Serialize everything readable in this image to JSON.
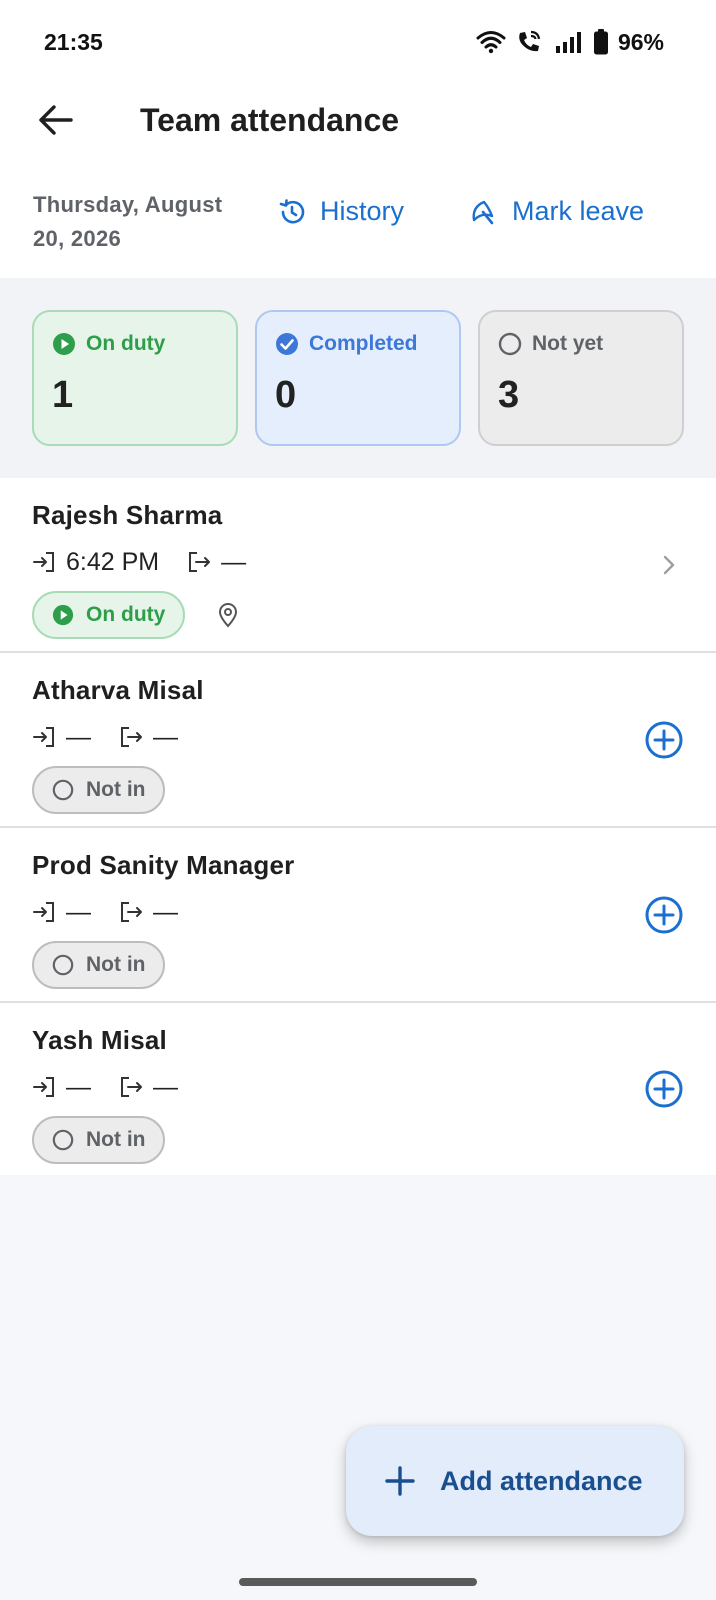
{
  "status_bar": {
    "time": "21:35",
    "battery": "96%",
    "icons": [
      "wifi-icon",
      "wifi-call-icon",
      "signal-icon",
      "battery-icon"
    ]
  },
  "header": {
    "title": "Team attendance",
    "back_icon": "arrow-left-icon"
  },
  "date_row": {
    "date": "Thursday, August 20, 2026",
    "history_label": "History",
    "mark_leave_label": "Mark leave"
  },
  "summary": {
    "on_duty": {
      "label": "On duty",
      "count": "1",
      "color": "#2e9e4a"
    },
    "completed": {
      "label": "Completed",
      "count": "0",
      "color": "#3d78d8"
    },
    "not_yet": {
      "label": "Not yet",
      "count": "3",
      "color": "#5f6368"
    }
  },
  "members": [
    {
      "name": "Rajesh Sharma",
      "check_in": "6:42 PM",
      "check_out": "—",
      "status": "On duty"
    },
    {
      "name": "Atharva Misal",
      "check_in": "—",
      "check_out": "—",
      "status": "Not in"
    },
    {
      "name": "Prod Sanity Manager",
      "check_in": "—",
      "check_out": "—",
      "status": "Not in"
    },
    {
      "name": "Yash Misal",
      "check_in": "—",
      "check_out": "—",
      "status": "Not in"
    }
  ],
  "fab": {
    "label": "Add attendance"
  },
  "colors": {
    "accent": "#1a6fcf",
    "fab_bg": "#e3ecfa",
    "fab_text": "#1a4f8f"
  }
}
